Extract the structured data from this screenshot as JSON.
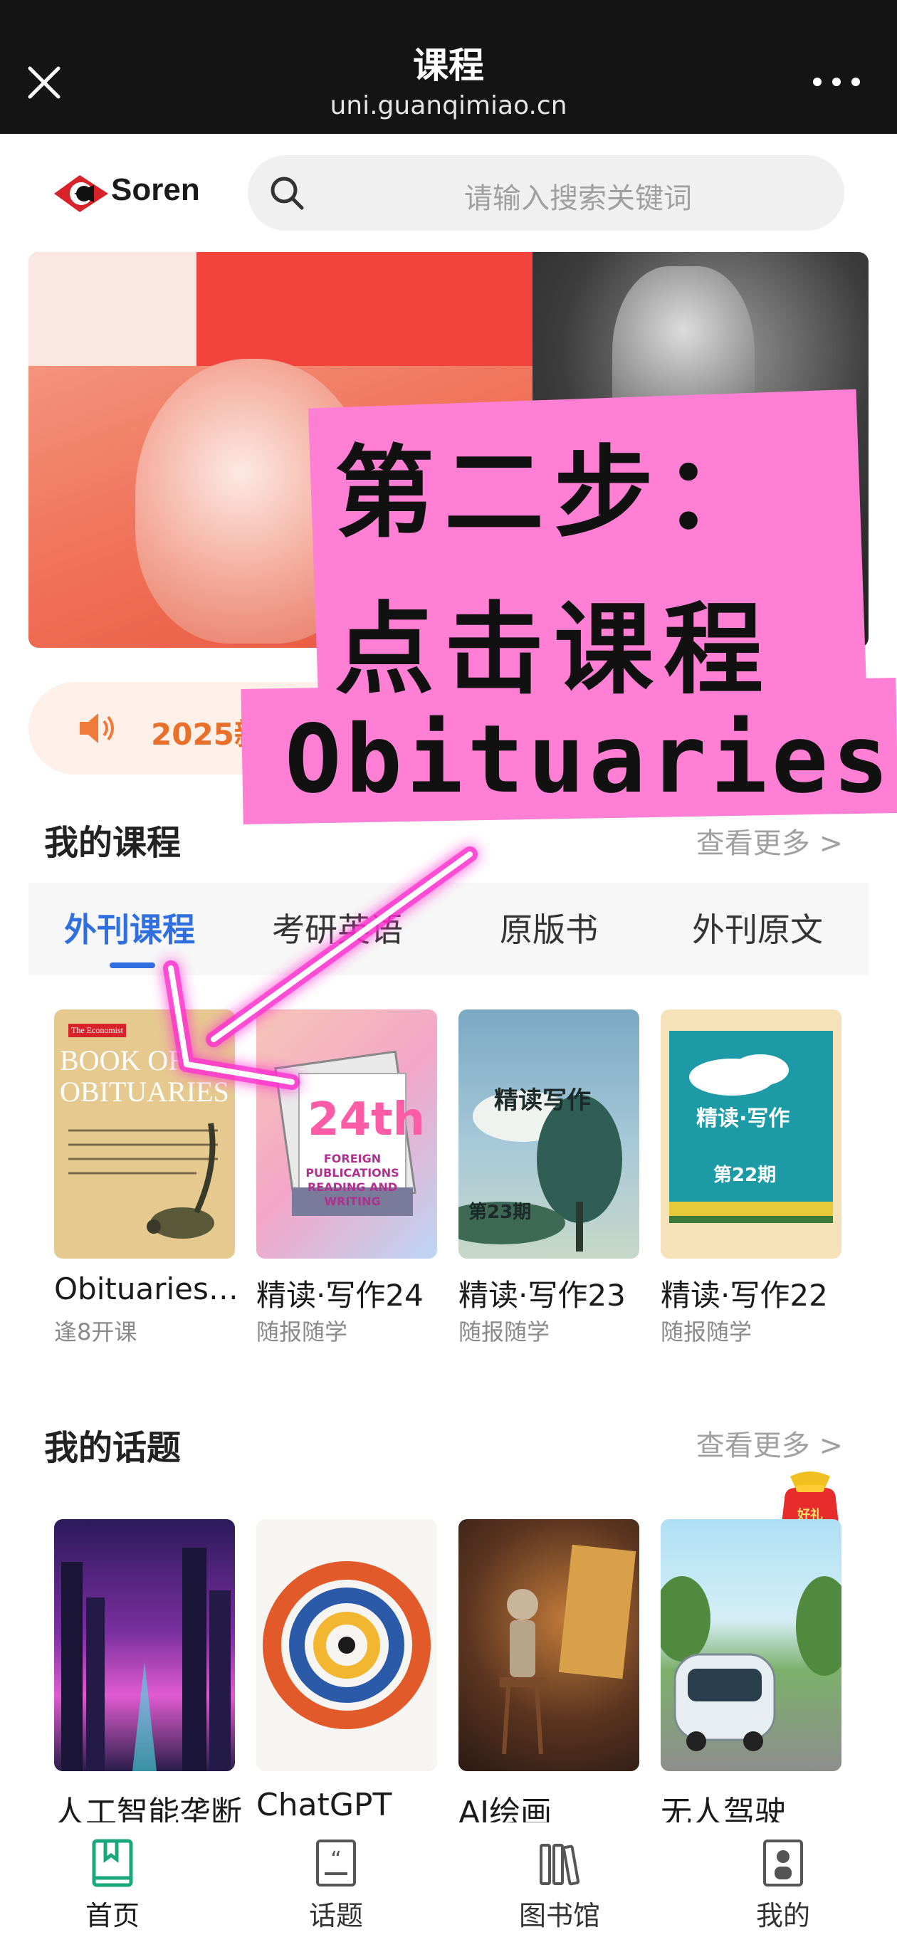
{
  "topbar": {
    "title": "课程",
    "domain": "uni.guanqimiao.cn"
  },
  "header": {
    "brand": "Soren",
    "search_placeholder": "请输入搜索关键词"
  },
  "notice": {
    "text": "2025新"
  },
  "courses": {
    "title": "我的课程",
    "more": "查看更多 >",
    "tabs": [
      {
        "label": "外刊课程",
        "active": true
      },
      {
        "label": "考研英语"
      },
      {
        "label": "原版书"
      },
      {
        "label": "外刊原文"
      }
    ],
    "items": [
      {
        "name": "Obituaries…",
        "sub": "逢8开课",
        "cover_title": "BOOK OF OBITUARIES",
        "cover_brand": "The Economist"
      },
      {
        "name": "精读·写作24",
        "sub": "随报随学",
        "cover_title": "24th",
        "cover_caption": "FOREIGN PUBLICATIONS READING AND WRITING"
      },
      {
        "name": "精读·写作23",
        "sub": "随报随学",
        "cover_title": "精读写作",
        "cover_issue": "第23期"
      },
      {
        "name": "精读·写作22",
        "sub": "随报随学",
        "cover_title": "精读·写作",
        "cover_issue": "第22期"
      }
    ]
  },
  "topics": {
    "title": "我的话题",
    "more": "查看更多 >",
    "items": [
      {
        "name": "人工智能垄断"
      },
      {
        "name": "ChatGPT"
      },
      {
        "name": "AI绘画"
      },
      {
        "name": "无人驾驶"
      }
    ],
    "lucky_bag_label": "好礼"
  },
  "overlay": {
    "line1": "第二步：",
    "line2": "点击课程",
    "line3": "Obituaries"
  },
  "bottom_nav": [
    {
      "label": "首页",
      "icon": "bookmark-book-icon",
      "active": true
    },
    {
      "label": "话题",
      "icon": "quote-icon"
    },
    {
      "label": "图书馆",
      "icon": "books-shelf-icon"
    },
    {
      "label": "我的",
      "icon": "profile-icon"
    }
  ],
  "colors": {
    "accent": "#2f6fe0",
    "notice_text": "#e8702a",
    "overlay_pink": "#ff7fd4",
    "nav_active": "#1aa87a"
  }
}
